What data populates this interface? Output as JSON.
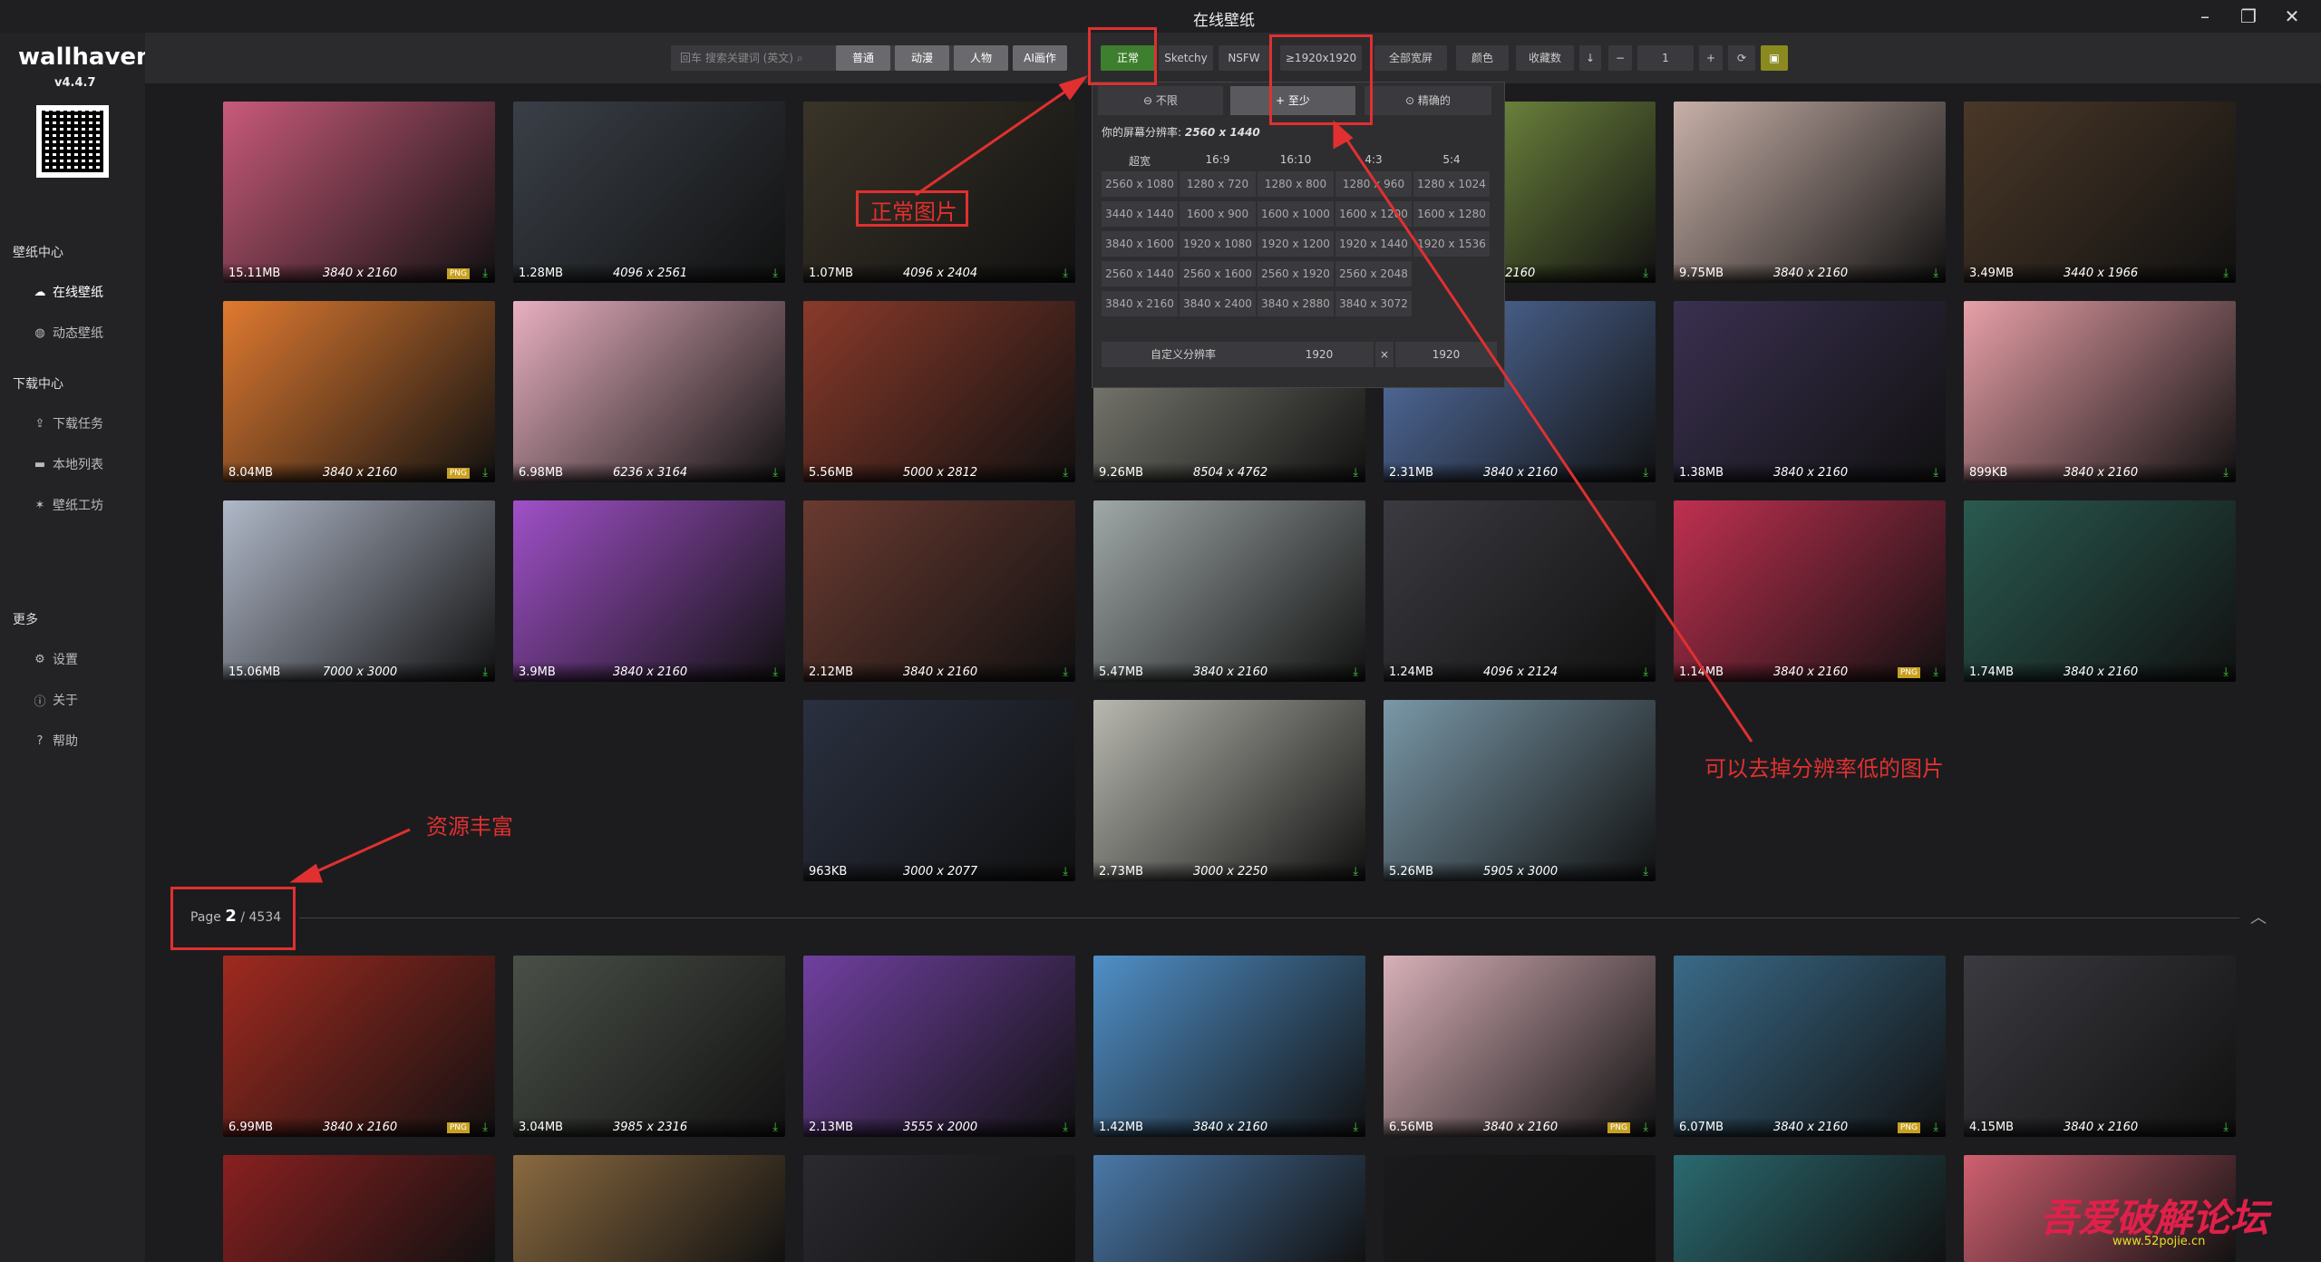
{
  "window": {
    "title": "在线壁纸"
  },
  "sidebar": {
    "logo": "wallhaven",
    "version": "v4.4.7",
    "sections": [
      {
        "label": "壁纸中心",
        "items": [
          {
            "label": "在线壁纸",
            "icon": "cloud-icon",
            "active": true
          },
          {
            "label": "动态壁纸",
            "icon": "palette-icon"
          }
        ]
      },
      {
        "label": "下载中心",
        "items": [
          {
            "label": "下载任务",
            "icon": "upload-icon"
          },
          {
            "label": "本地列表",
            "icon": "folder-icon"
          },
          {
            "label": "壁纸工坊",
            "icon": "star-icon"
          }
        ]
      },
      {
        "label": "更多",
        "items": [
          {
            "label": "设置",
            "icon": "gear-icon"
          },
          {
            "label": "关于",
            "icon": "info-icon"
          },
          {
            "label": "帮助",
            "icon": "help-icon"
          }
        ]
      }
    ]
  },
  "toolbar": {
    "search_placeholder": "回车 搜索关键词 (英文)",
    "categories": [
      "普通",
      "动漫",
      "人物",
      "AI画作"
    ],
    "purity": [
      "正常",
      "Sketchy",
      "NSFW"
    ],
    "resolution_filter": "≥1920x1920",
    "ratio": "全部宽屏",
    "color": "颜色",
    "sort": "收藏数",
    "page": "1"
  },
  "resolution_dropdown": {
    "tabs": [
      "不限",
      "至少",
      "精确的"
    ],
    "screen_label": "你的屏幕分辨率:",
    "screen_value": "2560 x 1440",
    "headers": [
      "超宽",
      "16:9",
      "16:10",
      "4:3",
      "5:4"
    ],
    "rows": [
      [
        "2560 x 1080",
        "1280 x 720",
        "1280 x 800",
        "1280 x 960",
        "1280 x 1024"
      ],
      [
        "3440 x 1440",
        "1600 x 900",
        "1600 x 1000",
        "1600 x 1200",
        "1600 x 1280"
      ],
      [
        "3840 x 1600",
        "1920 x 1080",
        "1920 x 1200",
        "1920 x 1440",
        "1920 x 1536"
      ],
      [
        "2560 x 1440",
        "2560 x 1600",
        "2560 x 1920",
        "2560 x 2048",
        ""
      ],
      [
        "3840 x 2160",
        "3840 x 2400",
        "3840 x 2880",
        "3840 x 3072",
        ""
      ]
    ],
    "custom_label": "自定义分辨率",
    "custom_w": "1920",
    "custom_x": "×",
    "custom_h": "1920"
  },
  "annotations": {
    "normal": "正常图片",
    "resolution": "可以去掉分辨率低的图片",
    "rich": "资源丰富"
  },
  "page_divider": {
    "prefix": "Page",
    "current": "2",
    "total": "/ 4534"
  },
  "thumbs_page1": [
    {
      "size": "15.11MB",
      "res": "3840 x 2160",
      "png": true,
      "c": "#c85a7a"
    },
    {
      "size": "1.28MB",
      "res": "4096 x 2561",
      "png": false,
      "c": "#3a4048"
    },
    {
      "size": "1.07MB",
      "res": "4096 x 2404",
      "png": false,
      "c": "#3a3428"
    },
    {
      "size": "",
      "res": "",
      "png": false,
      "c": "#202022"
    },
    {
      "size": "",
      "res": "0 x 2160",
      "png": false,
      "c": "#8aa84a"
    },
    {
      "size": "9.75MB",
      "res": "3840 x 2160",
      "png": false,
      "c": "#c8b0a8"
    },
    {
      "size": "3.49MB",
      "res": "3440 x 1966",
      "png": false,
      "c": "#4a3828"
    },
    {
      "size": "8.04MB",
      "res": "3840 x 2160",
      "png": true,
      "c": "#e07a30"
    },
    {
      "size": "6.98MB",
      "res": "6236 x 3164",
      "png": false,
      "c": "#e8b0c0"
    },
    {
      "size": "5.56MB",
      "res": "5000 x 2812",
      "png": false,
      "c": "#8a3a2a"
    },
    {
      "size": "9.26MB",
      "res": "8504 x 4762",
      "png": false,
      "c": "#8a8a80"
    },
    {
      "size": "2.31MB",
      "res": "3840 x 2160",
      "png": false,
      "c": "#5a78b0"
    },
    {
      "size": "1.38MB",
      "res": "3840 x 2160",
      "png": false,
      "c": "#3a3050"
    },
    {
      "size": "899KB",
      "res": "3840 x 2160",
      "png": false,
      "c": "#e8a0a8"
    },
    {
      "size": "15.06MB",
      "res": "7000 x 3000",
      "png": false,
      "c": "#b0b8c8"
    },
    {
      "size": "3.9MB",
      "res": "3840 x 2160",
      "png": false,
      "c": "#a050c8"
    },
    {
      "size": "2.12MB",
      "res": "3840 x 2160",
      "png": false,
      "c": "#6a3a30"
    },
    {
      "size": "5.47MB",
      "res": "3840 x 2160",
      "png": false,
      "c": "#a0a8a8"
    },
    {
      "size": "1.24MB",
      "res": "4096 x 2124",
      "png": false,
      "c": "#3a3a40"
    },
    {
      "size": "1.14MB",
      "res": "3840 x 2160",
      "png": true,
      "c": "#c03050"
    },
    {
      "size": "1.74MB",
      "res": "3840 x 2160",
      "png": false,
      "c": "#2a5a50"
    },
    {
      "size": "963KB",
      "res": "3000 x 2077",
      "png": false,
      "c": "#2a3040"
    },
    {
      "size": "2.73MB",
      "res": "3000 x 2250",
      "png": false,
      "c": "#b8b8b0"
    },
    {
      "size": "5.26MB",
      "res": "5905 x 3000",
      "png": false,
      "c": "#7a98a8"
    }
  ],
  "thumbs_page2": [
    {
      "size": "6.99MB",
      "res": "3840 x 2160",
      "png": true,
      "c": "#a02a20"
    },
    {
      "size": "3.04MB",
      "res": "3985 x 2316",
      "png": false,
      "c": "#4a5048"
    },
    {
      "size": "2.13MB",
      "res": "3555 x 2000",
      "png": false,
      "c": "#7040a0"
    },
    {
      "size": "1.42MB",
      "res": "3840 x 2160",
      "png": false,
      "c": "#5090c8"
    },
    {
      "size": "6.56MB",
      "res": "3840 x 2160",
      "png": true,
      "c": "#d8b0b8"
    },
    {
      "size": "6.07MB",
      "res": "3840 x 2160",
      "png": true,
      "c": "#3a6a88"
    },
    {
      "size": "4.15MB",
      "res": "3840 x 2160",
      "png": false,
      "c": "#3a3a40"
    }
  ],
  "thumbs_row4": [
    {
      "c": "#8a2020"
    },
    {
      "c": "#8a6a40"
    },
    {
      "c": "#2a2a30"
    },
    {
      "c": "#4a78a8"
    },
    {
      "c": "#1a1a1c"
    },
    {
      "c": "#2a6a70"
    },
    {
      "c": "#d06070"
    }
  ],
  "watermark": {
    "text": "吾爱破解论坛",
    "url": "www.52pojie.cn"
  }
}
